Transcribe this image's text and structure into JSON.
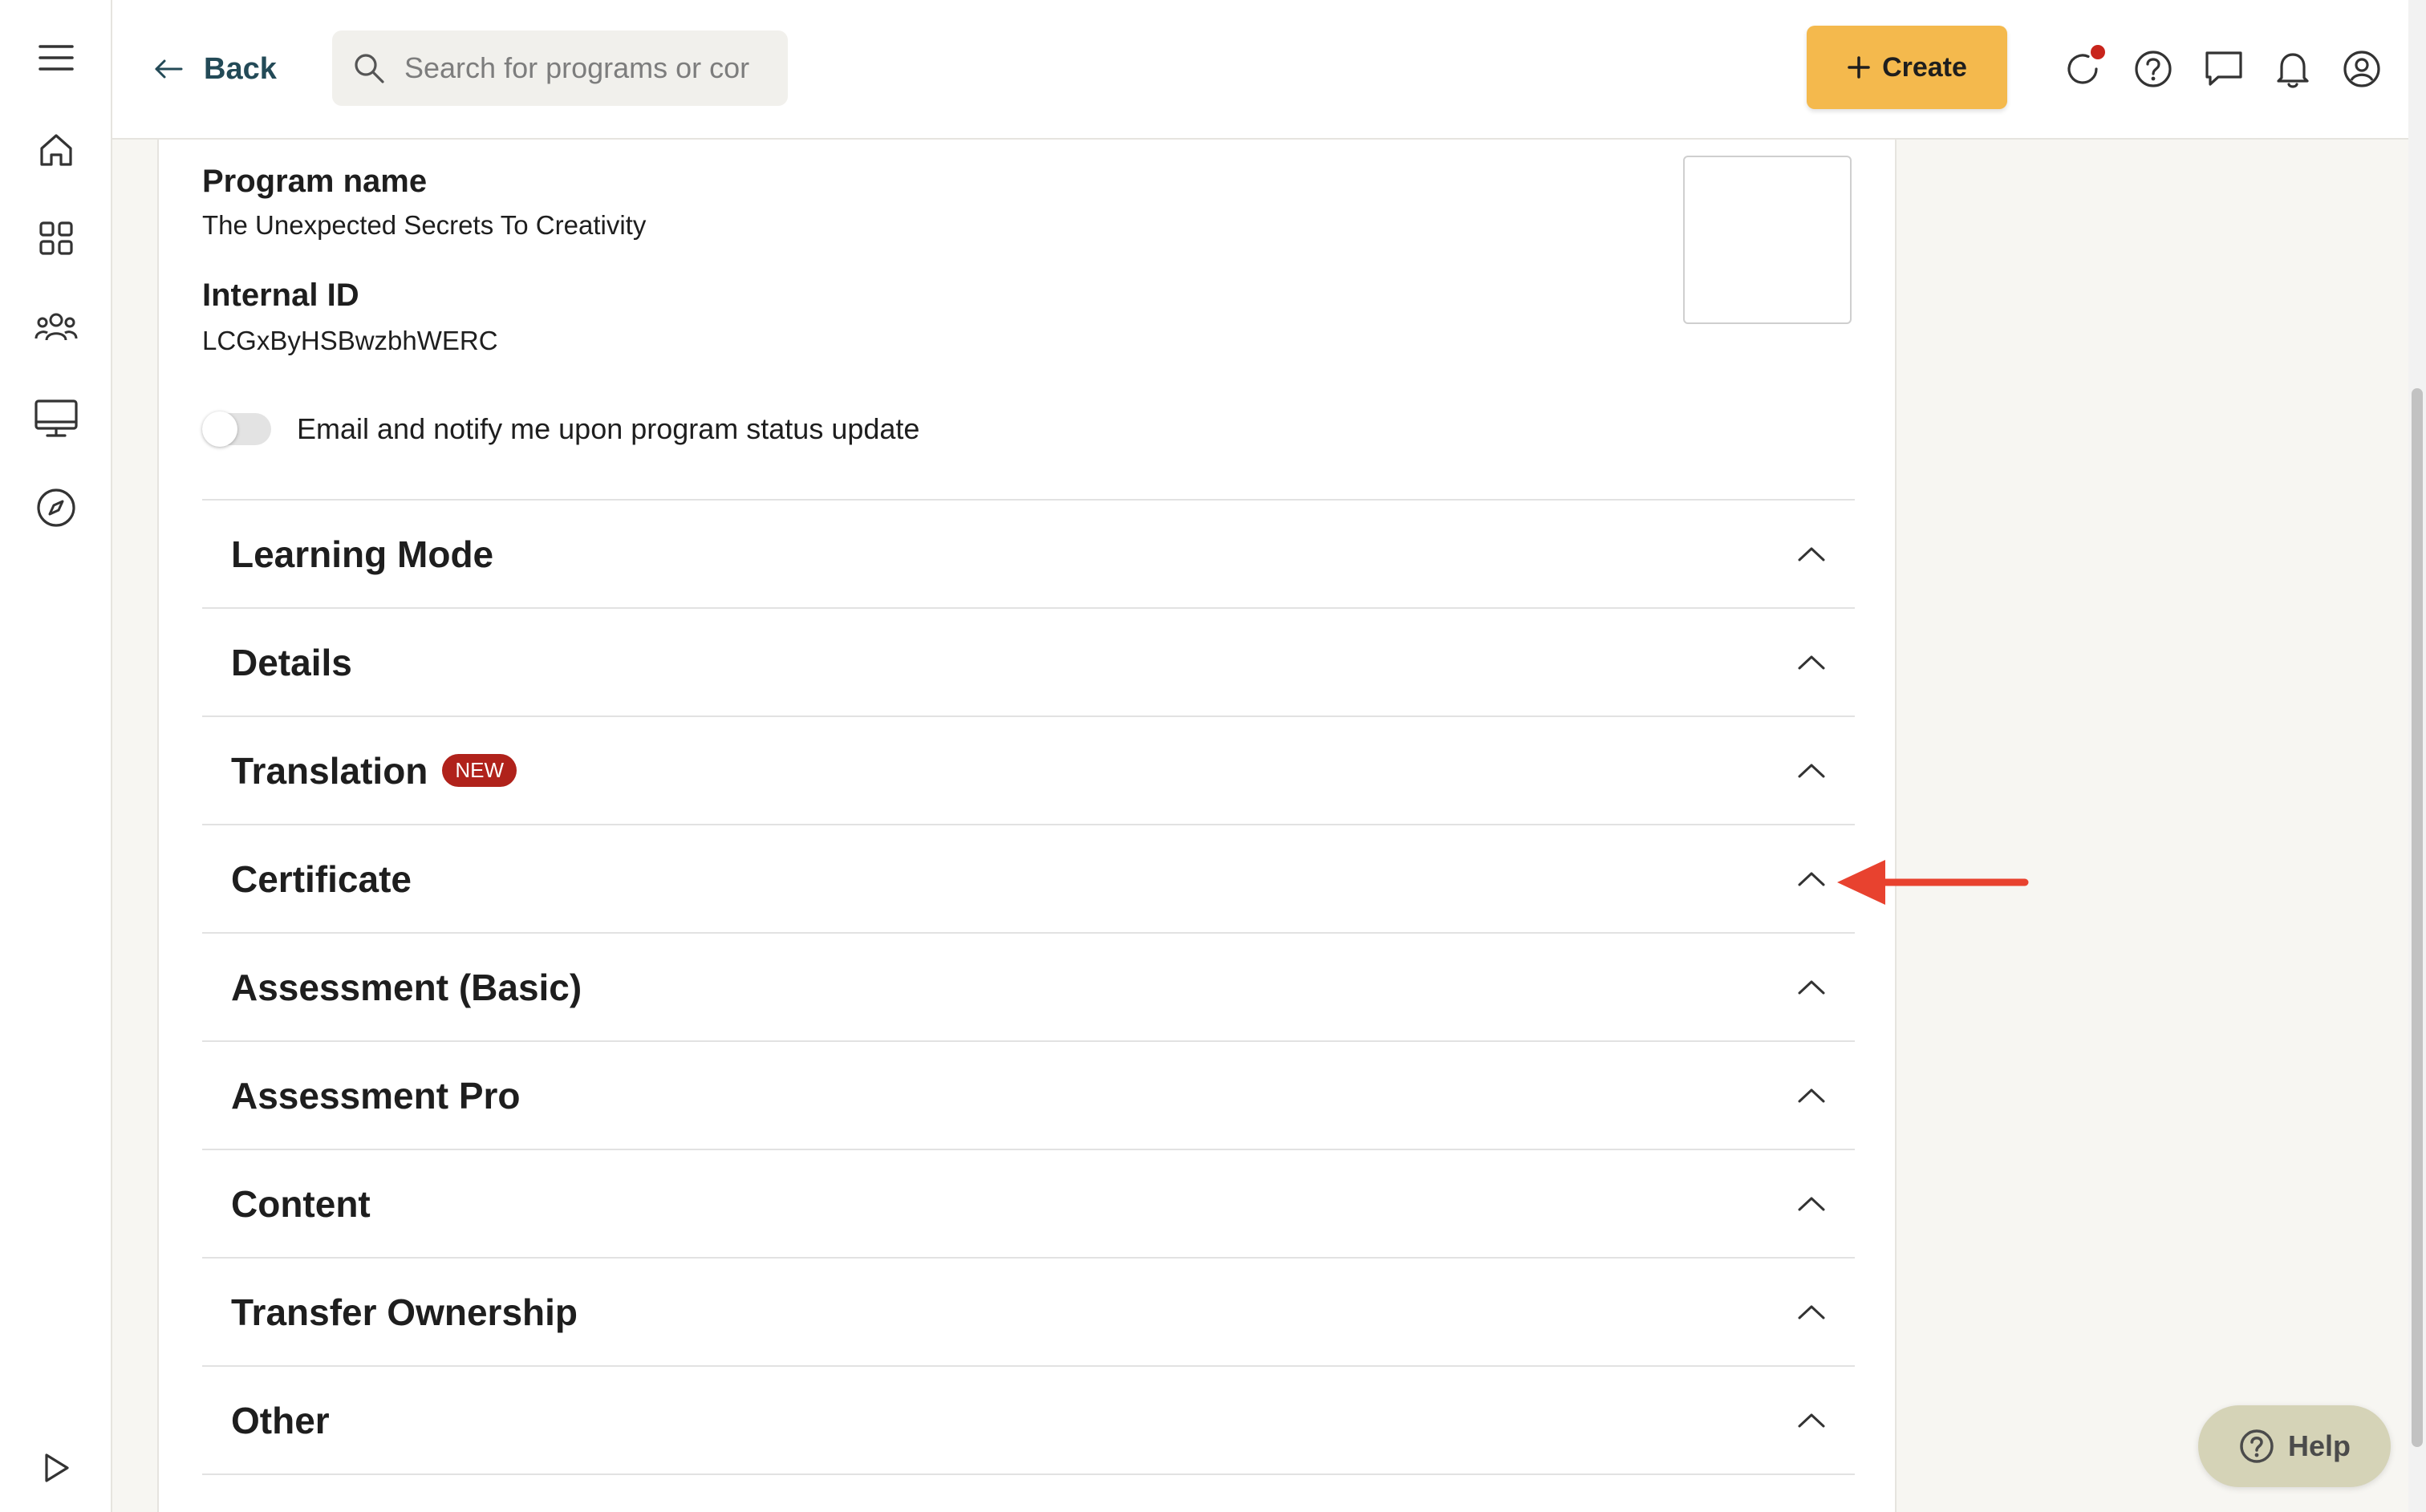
{
  "nav_rail": {
    "icons": [
      "menu-icon",
      "home-icon",
      "grid-icon",
      "people-icon",
      "monitor-icon",
      "compass-icon",
      "play-icon"
    ]
  },
  "header": {
    "back_label": "Back",
    "search_placeholder": "Search for programs or cor",
    "create_label": "Create",
    "icons": [
      "refresh-icon",
      "question-icon",
      "chat-icon",
      "bell-icon",
      "account-icon"
    ],
    "notification_dot_color": "#c8241b",
    "create_color": "#f4b94d"
  },
  "program": {
    "name_label": "Program name",
    "name_value": "The Unexpected Secrets To Creativity",
    "id_label": "Internal ID",
    "id_value": "LCGxByHSBwzbhWERC",
    "notify_label": "Email and notify me upon program status update",
    "notify_enabled": false
  },
  "sections": [
    {
      "title": "Learning Mode"
    },
    {
      "title": "Details"
    },
    {
      "title": "Translation",
      "badge": "NEW"
    },
    {
      "title": "Certificate",
      "highlighted": true
    },
    {
      "title": "Assessment (Basic)"
    },
    {
      "title": "Assessment Pro"
    },
    {
      "title": "Content"
    },
    {
      "title": "Transfer Ownership"
    },
    {
      "title": "Other"
    }
  ],
  "annotation": {
    "type": "arrow",
    "color": "#e8422f",
    "points_to": "Certificate"
  },
  "help_button": {
    "label": "Help"
  }
}
